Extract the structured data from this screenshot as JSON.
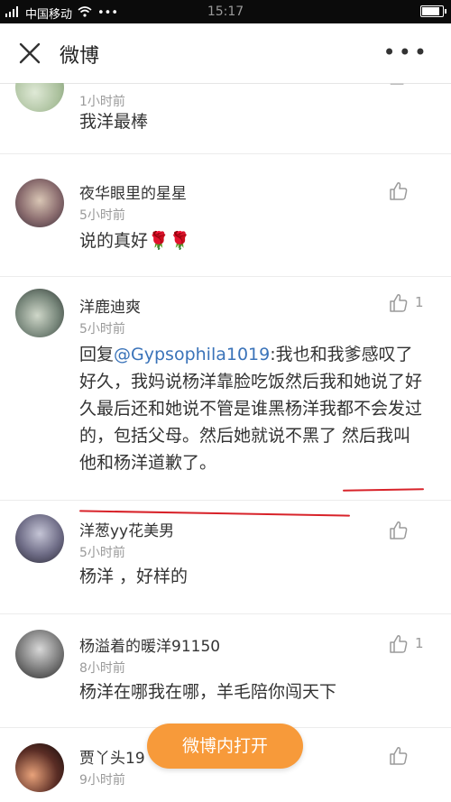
{
  "status_bar": {
    "carrier": "中国移动",
    "time": "15:17",
    "battery_level": 0.85
  },
  "header": {
    "title": "微博",
    "close_icon": "close-icon",
    "more_icon": "more-icon",
    "more_label": "•••"
  },
  "comments": [
    {
      "name": "",
      "time": "1小时前",
      "text": "我洋最棒",
      "likes": ""
    },
    {
      "name": "夜华眼里的星星",
      "time": "5小时前",
      "text": "说的真好🌹🌹",
      "likes": ""
    },
    {
      "name": "洋鹿迪爽",
      "time": "5小时前",
      "reply_prefix": "回复",
      "mention": "@Gypsophila1019",
      "text": ":我也和我爹感叹了好久，我妈说杨洋靠脸吃饭然后我和她说了好久最后还和她说不管是谁黑杨洋我都不会发过的，包括父母。然后她就说不黑了 然后我叫他和杨洋道歉了。",
      "likes": "1"
    },
    {
      "name": "洋葱yy花美男",
      "time": "5小时前",
      "text": "杨洋 ，好样的",
      "likes": ""
    },
    {
      "name": "杨溢着的暖洋91150",
      "time": "8小时前",
      "text": "杨洋在哪我在哪，羊毛陪你闯天下",
      "likes": "1"
    },
    {
      "name": "贾丫头19",
      "time": "9小时前",
      "text": "",
      "likes": ""
    }
  ],
  "open_button": {
    "label": "微博内打开"
  },
  "colors": {
    "accent_orange": "#f79a3a",
    "mention_blue": "#3a73b9",
    "underline_red": "#d8232a"
  }
}
